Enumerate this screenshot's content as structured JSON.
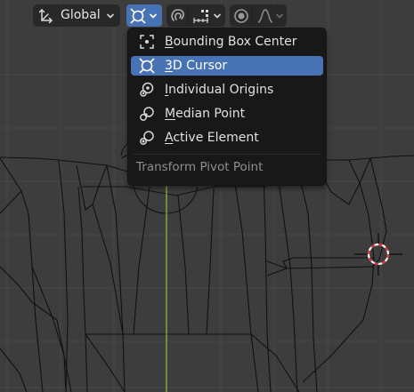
{
  "header": {
    "orientation": {
      "label": "Global",
      "icon": "transform-orientation-icon"
    },
    "pivot_button_icon": "3d-cursor-icon",
    "snap_icon": "snap-magnet-icon",
    "snap_mode_icon": "snap-increment-icon",
    "proportional_icon": "proportional-editing-icon",
    "falloff_icon": "falloff-curve-icon"
  },
  "pivot_menu": {
    "items": [
      {
        "label_first": "B",
        "label_rest": "ounding Box Center",
        "icon": "bounding-box-center-icon",
        "selected": false
      },
      {
        "label_first": "3",
        "label_rest": "D Cursor",
        "icon": "3d-cursor-icon",
        "selected": true
      },
      {
        "label_first": "I",
        "label_rest": "ndividual Origins",
        "icon": "individual-origins-icon",
        "selected": false
      },
      {
        "label_first": "M",
        "label_rest": "edian Point",
        "icon": "median-point-icon",
        "selected": false
      },
      {
        "label_first": "A",
        "label_rest": "ctive Element",
        "icon": "active-element-icon",
        "selected": false
      }
    ],
    "title": "Transform Pivot Point"
  },
  "colors": {
    "background": "#3d3d3d",
    "menu_bg": "#181818",
    "selected": "#4772b3",
    "mesh_wire": "#111111",
    "y_axis": "#8bbb3a",
    "cursor_red": "#e0303a"
  }
}
